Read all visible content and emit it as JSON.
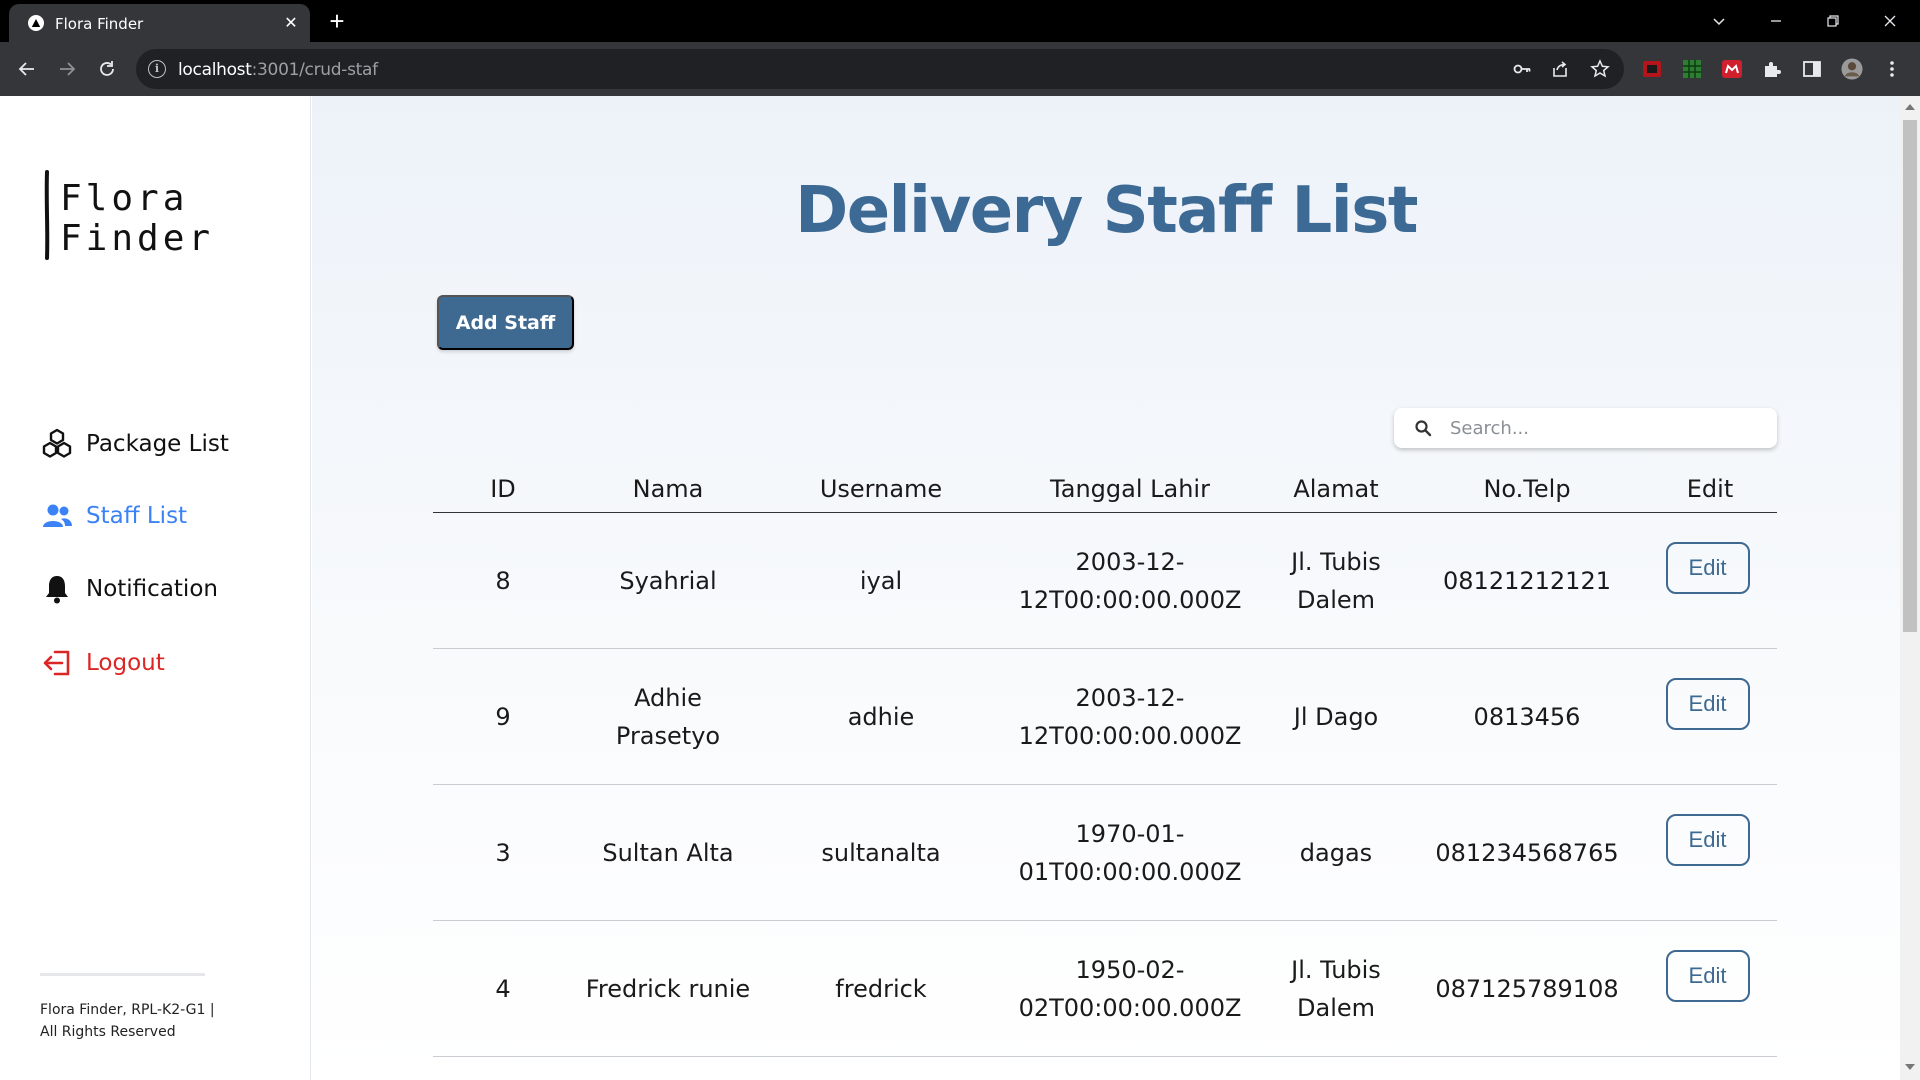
{
  "browser": {
    "tab_title": "Flora Finder",
    "url_host": "localhost",
    "url_path": ":3001/crud-staf"
  },
  "sidebar": {
    "logo_line1": "Flora",
    "logo_line2": "Finder",
    "items": [
      {
        "label": "Package List",
        "icon": "package-icon"
      },
      {
        "label": "Staff List",
        "icon": "users-icon"
      },
      {
        "label": "Notification",
        "icon": "bell-icon"
      },
      {
        "label": "Logout",
        "icon": "logout-icon"
      }
    ],
    "footer_line1": "Flora Finder, RPL-K2-G1 |",
    "footer_line2": "All Rights Reserved"
  },
  "main": {
    "title": "Delivery Staff List",
    "add_button": "Add Staff",
    "search_placeholder": "Search..."
  },
  "table": {
    "headers": [
      "ID",
      "Nama",
      "Username",
      "Tanggal Lahir",
      "Alamat",
      "No.Telp",
      "Edit"
    ],
    "rows": [
      {
        "id": "8",
        "nama": "Syahrial",
        "username": "iyal",
        "tanggal_lahir": "2003-12-12T00:00:00.000Z",
        "alamat": "Jl. Tubis Dalem",
        "telp": "08121212121",
        "edit": "Edit"
      },
      {
        "id": "9",
        "nama": "Adhie Prasetyo",
        "username": "adhie",
        "tanggal_lahir": "2003-12-12T00:00:00.000Z",
        "alamat": "Jl Dago",
        "telp": "0813456",
        "edit": "Edit"
      },
      {
        "id": "3",
        "nama": "Sultan Alta",
        "username": "sultanalta",
        "tanggal_lahir": "1970-01-01T00:00:00.000Z",
        "alamat": "dagas",
        "telp": "081234568765",
        "edit": "Edit"
      },
      {
        "id": "4",
        "nama": "Fredrick runie",
        "username": "fredrick",
        "tanggal_lahir": "1950-02-02T00:00:00.000Z",
        "alamat": "Jl. Tubis Dalem",
        "telp": "087125789108",
        "edit": "Edit"
      }
    ]
  },
  "colors": {
    "primary": "#3e6a92",
    "active_nav": "#3b82f6",
    "logout": "#dc2626"
  }
}
